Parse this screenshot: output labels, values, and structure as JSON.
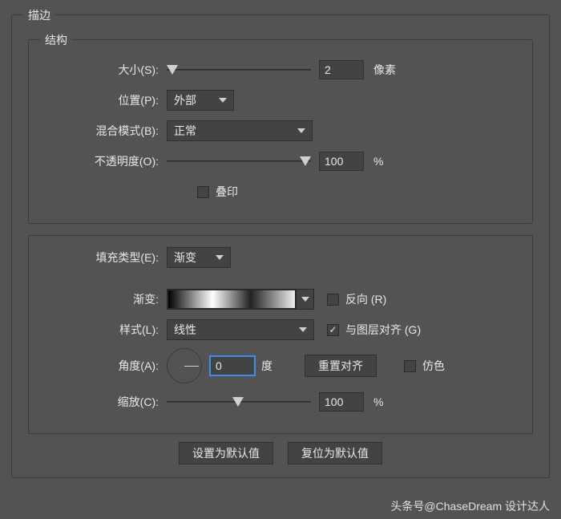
{
  "panel": {
    "title": "描边"
  },
  "structure": {
    "title": "结构",
    "size_label": "大小(S):",
    "size_value": "2",
    "size_unit": "像素",
    "position_label": "位置(P):",
    "position_value": "外部",
    "blend_label": "混合模式(B):",
    "blend_value": "正常",
    "opacity_label": "不透明度(O):",
    "opacity_value": "100",
    "opacity_unit": "%",
    "overprint_label": "叠印"
  },
  "fill": {
    "type_label": "填充类型(E):",
    "type_value": "渐变",
    "gradient_label": "渐变:",
    "reverse_label": "反向 (R)",
    "style_label": "样式(L):",
    "style_value": "线性",
    "align_label": "与图层对齐 (G)",
    "angle_label": "角度(A):",
    "angle_value": "0",
    "angle_unit": "度",
    "reset_align_label": "重置对齐",
    "dither_label": "仿色",
    "scale_label": "缩放(C):",
    "scale_value": "100",
    "scale_unit": "%"
  },
  "buttons": {
    "set_default": "设置为默认值",
    "reset_default": "复位为默认值"
  },
  "watermark": "头条号@ChaseDream 设计达人"
}
